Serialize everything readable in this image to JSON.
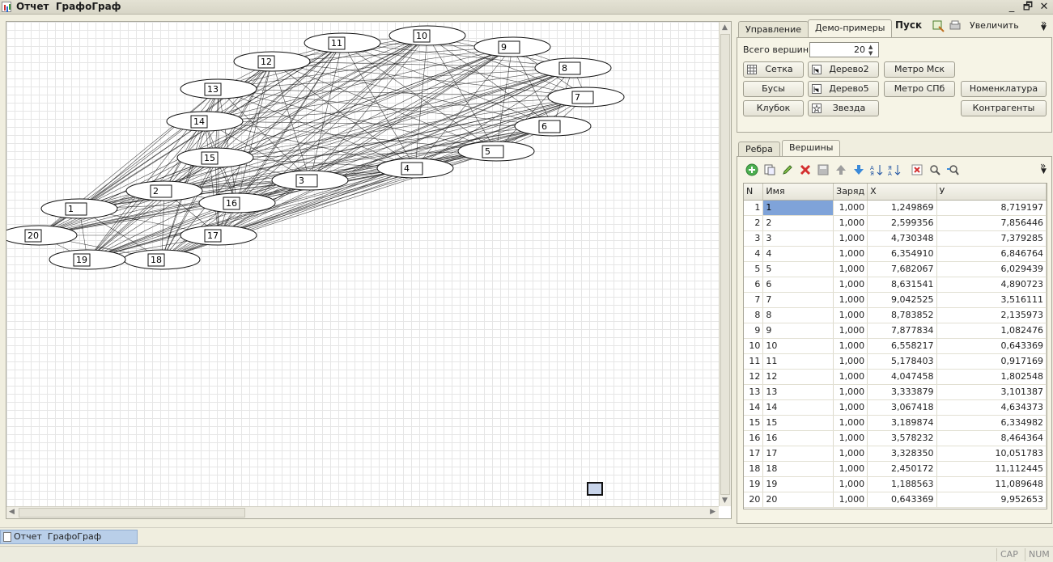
{
  "window": {
    "title": "Отчет  ГрафоГраф",
    "minimize": "_",
    "restore": "🗗",
    "close": "✕"
  },
  "top_tabs": {
    "manage": "Управление",
    "demo": "Демо-примеры",
    "start": "Пуск",
    "zoom": "Увеличить",
    "more": "»"
  },
  "demo": {
    "total_label": "Всего вершин:",
    "total_value": "20",
    "buttons": {
      "grid": "Сетка",
      "tree2": "Дерево2",
      "metro_msk": "Метро Мск",
      "beads": "Бусы",
      "tree5": "Дерево5",
      "metro_spb": "Метро СПб",
      "nomenclature": "Номенклатура",
      "ball": "Клубок",
      "star": "Звезда",
      "contractors": "Контрагенты"
    }
  },
  "lower_tabs": {
    "edges": "Ребра",
    "vertices": "Вершины"
  },
  "toolbar_more": "»",
  "table": {
    "headers": {
      "n": "N",
      "name": "Имя",
      "charge": "Заряд",
      "x": "X",
      "y": "У"
    },
    "rows": [
      {
        "n": "1",
        "name": "1",
        "charge": "1,000",
        "x": "1,249869",
        "y": "8,719197"
      },
      {
        "n": "2",
        "name": "2",
        "charge": "1,000",
        "x": "2,599356",
        "y": "7,856446"
      },
      {
        "n": "3",
        "name": "3",
        "charge": "1,000",
        "x": "4,730348",
        "y": "7,379285"
      },
      {
        "n": "4",
        "name": "4",
        "charge": "1,000",
        "x": "6,354910",
        "y": "6,846764"
      },
      {
        "n": "5",
        "name": "5",
        "charge": "1,000",
        "x": "7,682067",
        "y": "6,029439"
      },
      {
        "n": "6",
        "name": "6",
        "charge": "1,000",
        "x": "8,631541",
        "y": "4,890723"
      },
      {
        "n": "7",
        "name": "7",
        "charge": "1,000",
        "x": "9,042525",
        "y": "3,516111"
      },
      {
        "n": "8",
        "name": "8",
        "charge": "1,000",
        "x": "8,783852",
        "y": "2,135973"
      },
      {
        "n": "9",
        "name": "9",
        "charge": "1,000",
        "x": "7,877834",
        "y": "1,082476"
      },
      {
        "n": "10",
        "name": "10",
        "charge": "1,000",
        "x": "6,558217",
        "y": "0,643369"
      },
      {
        "n": "11",
        "name": "11",
        "charge": "1,000",
        "x": "5,178403",
        "y": "0,917169"
      },
      {
        "n": "12",
        "name": "12",
        "charge": "1,000",
        "x": "4,047458",
        "y": "1,802548"
      },
      {
        "n": "13",
        "name": "13",
        "charge": "1,000",
        "x": "3,333879",
        "y": "3,101387"
      },
      {
        "n": "14",
        "name": "14",
        "charge": "1,000",
        "x": "3,067418",
        "y": "4,634373"
      },
      {
        "n": "15",
        "name": "15",
        "charge": "1,000",
        "x": "3,189874",
        "y": "6,334982"
      },
      {
        "n": "16",
        "name": "16",
        "charge": "1,000",
        "x": "3,578232",
        "y": "8,464364"
      },
      {
        "n": "17",
        "name": "17",
        "charge": "1,000",
        "x": "3,328350",
        "y": "10,051783"
      },
      {
        "n": "18",
        "name": "18",
        "charge": "1,000",
        "x": "2,450172",
        "y": "11,112445"
      },
      {
        "n": "19",
        "name": "19",
        "charge": "1,000",
        "x": "1,188563",
        "y": "11,089648"
      },
      {
        "n": "20",
        "name": "20",
        "charge": "1,000",
        "x": "0,643369",
        "y": "9,952653"
      }
    ]
  },
  "graph": {
    "vertex_labels": [
      "1",
      "2",
      "3",
      "4",
      "5",
      "6",
      "7",
      "8",
      "9",
      "10",
      "11",
      "12",
      "13",
      "14",
      "15",
      "16",
      "17",
      "18",
      "19",
      "20"
    ]
  },
  "taskbar": {
    "item": "Отчет  ГрафоГраф"
  },
  "status": {
    "cap": "CAP",
    "num": "NUM"
  }
}
